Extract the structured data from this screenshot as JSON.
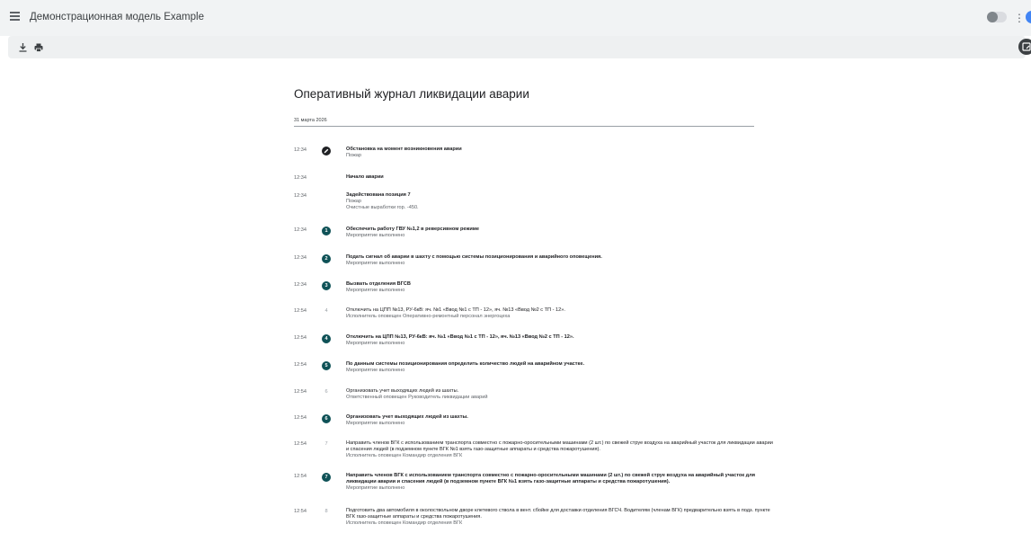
{
  "header": {
    "title": "Демонстрационная модель Example",
    "more_glyph": "⋮",
    "avatar_initial": "👤"
  },
  "toolbar": {
    "download_icon": "download-icon",
    "print_icon": "print-icon",
    "fab_icon": "calendar-edit-icon"
  },
  "journal": {
    "title": "Оперативный журнал ликвидации аварии",
    "date": "31 марта 2026",
    "accent_color": "#0f5257",
    "entries": [
      {
        "time": "12:34",
        "marker": "edit",
        "num": "",
        "title": "Обстановка на момент возникновения аварии",
        "bold": true,
        "lines": [
          "Пожар"
        ]
      },
      {
        "time": "12:34",
        "marker": "none",
        "num": "",
        "title": "Начало аварии",
        "bold": true,
        "lines": []
      },
      {
        "time": "12:34",
        "marker": "none",
        "num": "",
        "title": "Задействована позиция 7",
        "bold": true,
        "lines": [
          "Пожар",
          "Очистные выработки гор. -450."
        ]
      },
      {
        "time": "12:34",
        "marker": "badge",
        "num": "1",
        "title": "Обеспечить работу ГВУ №1,2 в реверсивном режиме",
        "bold": true,
        "lines": [
          "Мероприятие выполнено"
        ]
      },
      {
        "time": "12:34",
        "marker": "badge",
        "num": "2",
        "title": "Подать сигнал об аварии в шахту с помощью системы позиционирования и аварийного оповещения.",
        "bold": true,
        "lines": [
          "Мероприятие выполнено"
        ]
      },
      {
        "time": "12:34",
        "marker": "badge",
        "num": "3",
        "title": "Вызвать отделения ВГСВ",
        "bold": true,
        "lines": [
          "Мероприятие выполнено"
        ]
      },
      {
        "time": "12:54",
        "marker": "plain",
        "num": "4",
        "title": "Отключить на ЦПП №13, РУ-6кВ: яч. №1 «Ввод №1 с ТП - 12», яч. №13 «Ввод №2 с ТП - 12».",
        "bold": false,
        "lines": [
          "Исполнитель оповещен Оперативно-ремонтный персонал энергоцеха"
        ]
      },
      {
        "time": "12:54",
        "marker": "badge",
        "num": "4",
        "title": "Отключить на ЦПП №13, РУ-6кВ: яч. №1 «Ввод №1 с ТП - 12», яч. №13 «Ввод №2 с ТП - 12».",
        "bold": true,
        "lines": [
          "Мероприятие выполнено"
        ]
      },
      {
        "time": "12:54",
        "marker": "badge",
        "num": "5",
        "title": "По данным системы позиционирования определить количество людей на аварийном участке.",
        "bold": true,
        "lines": [
          "Мероприятие выполнено"
        ]
      },
      {
        "time": "12:54",
        "marker": "plain",
        "num": "6",
        "title": "Организовать учет выходящих людей из шахты.",
        "bold": false,
        "lines": [
          "Ответственный оповещен Руководитель ликвидации аварий"
        ]
      },
      {
        "time": "12:54",
        "marker": "badge",
        "num": "6",
        "title": "Организовать учет выходящих людей из шахты.",
        "bold": true,
        "lines": [
          "Мероприятие выполнено"
        ]
      },
      {
        "time": "12:54",
        "marker": "plain",
        "num": "7",
        "title": "Направить членов ВГК с использованием транспорта совместно с пожарно-оросительными машинами (2 шт.) по свежей струе воздуха на аварийный участок для ликвидации аварии и спасения людей (в подземном пункте ВГК №1 взять газо-защитные аппараты и средства пожаротушения).",
        "bold": false,
        "lines": [
          "Исполнитель оповещен Командир отделения ВГК"
        ]
      },
      {
        "time": "12:54",
        "marker": "badge",
        "num": "7",
        "title": "Направить членов ВГК с использованием транспорта совместно с пожарно-оросительными машинами (2 шт.) по свежей струе воздуха на аварийный участок для ликвидации аварии и спасения людей (в подземном пункте ВГК №1 взять газо-защитные аппараты и средства пожаротушения).",
        "bold": true,
        "lines": [
          "Мероприятие выполнено"
        ]
      },
      {
        "time": "12:54",
        "marker": "plain",
        "num": "8",
        "title": "Подготовить два автомобиля в околоствольном дворе клетевого ствола в вент. сбойке для доставки отделения ВГСЧ. Водителям (членам ВГК) предварительно взять в подз. пункте ВГК газо-защитные аппараты и средства пожаротушения.",
        "bold": false,
        "lines": [
          "Исполнитель оповещен Командир отделения ВГК"
        ]
      }
    ]
  }
}
